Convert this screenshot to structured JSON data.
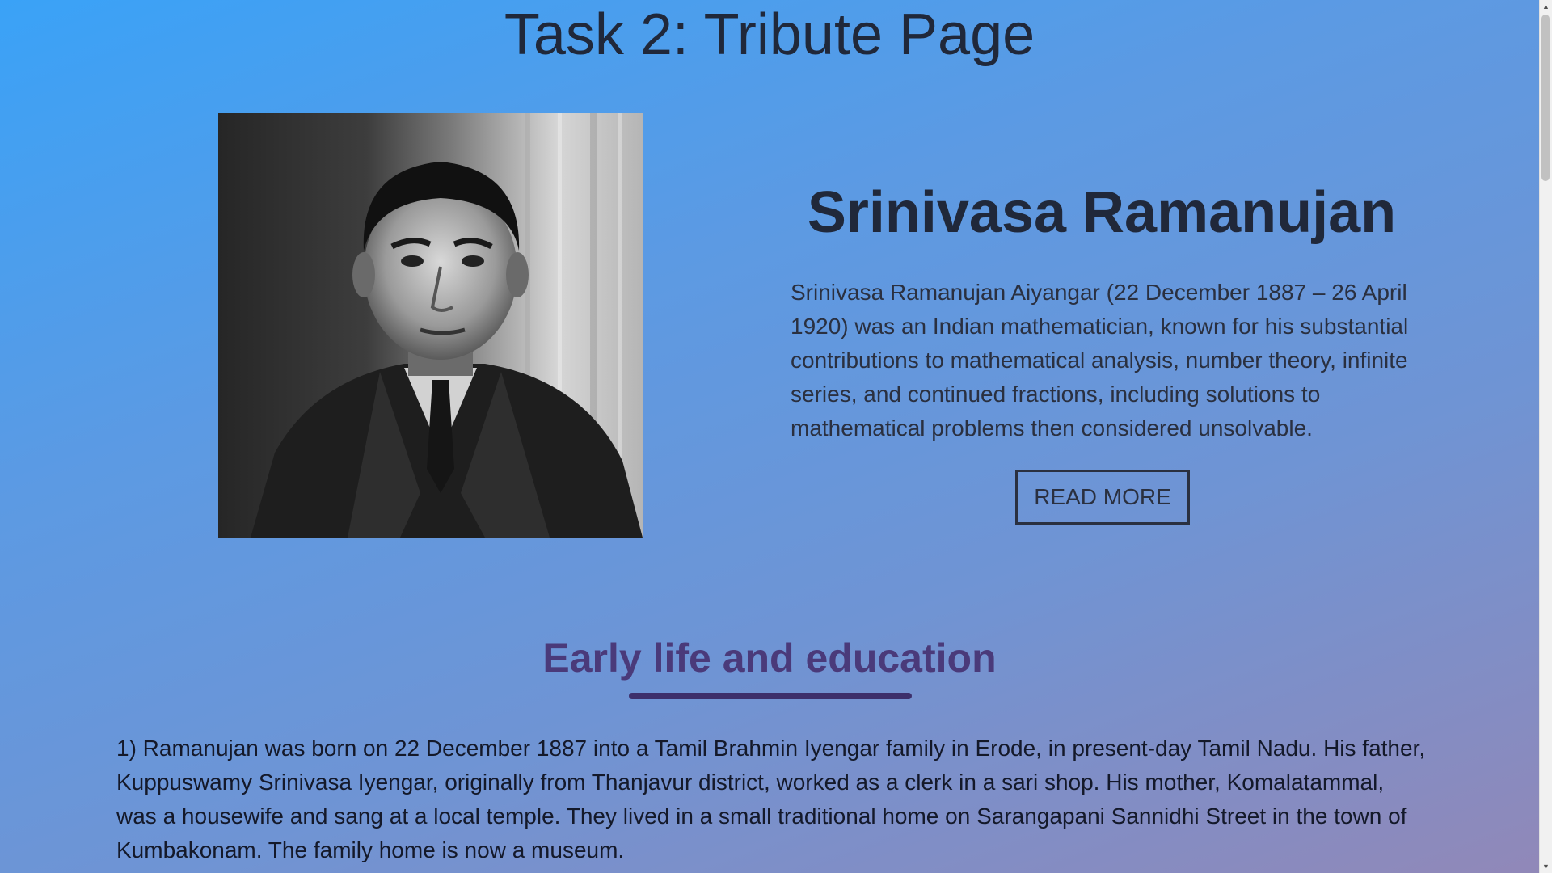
{
  "page": {
    "title": "Task 2: Tribute Page"
  },
  "hero": {
    "name": "Srinivasa Ramanujan",
    "bio": "Srinivasa Ramanujan Aiyangar (22 December 1887 – 26 April 1920) was an Indian mathematician, known for his substantial contributions to mathematical analysis, number theory, infinite series, and continued fractions, including solutions to mathematical problems then considered unsolvable.",
    "read_more_label": "READ MORE"
  },
  "section": {
    "heading": "Early life and education",
    "paragraph": "1) Ramanujan was born on 22 December 1887 into a Tamil Brahmin Iyengar family in Erode, in present-day Tamil Nadu. His father, Kuppuswamy Srinivasa Iyengar, originally from Thanjavur district, worked as a clerk in a sari shop. His mother, Komalatammal, was a housewife and sang at a local temple. They lived in a small traditional home on Sarangapani Sannidhi Street in the town of Kumbakonam. The family home is now a museum."
  },
  "icons": {
    "scroll_up": "scroll-up-arrow-icon",
    "scroll_down": "scroll-down-arrow-icon"
  }
}
